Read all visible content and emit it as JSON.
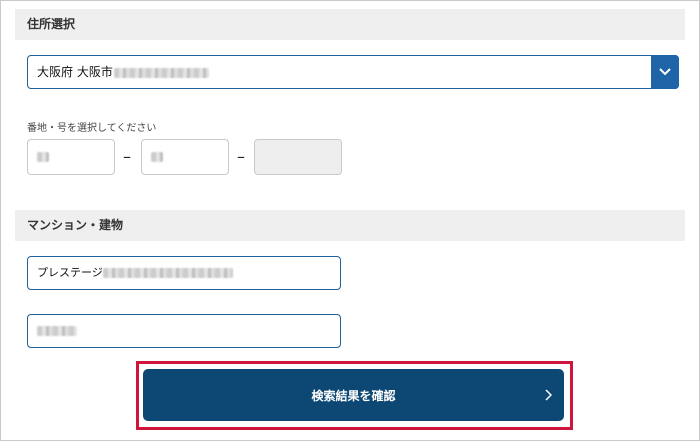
{
  "address_section": {
    "title": "住所選択",
    "select": {
      "value": "大阪府 大阪市"
    },
    "lot_hint": "番地・号を選択してください",
    "lot_separator": "–"
  },
  "building_section": {
    "title": "マンション・建物",
    "building_name": "プレステージ"
  },
  "confirm_button": {
    "label": "検索結果を確認"
  },
  "colors": {
    "accent": "#1d65a6",
    "button": "#0d4874",
    "highlight": "#d0143c",
    "section_bg": "#efefef"
  }
}
